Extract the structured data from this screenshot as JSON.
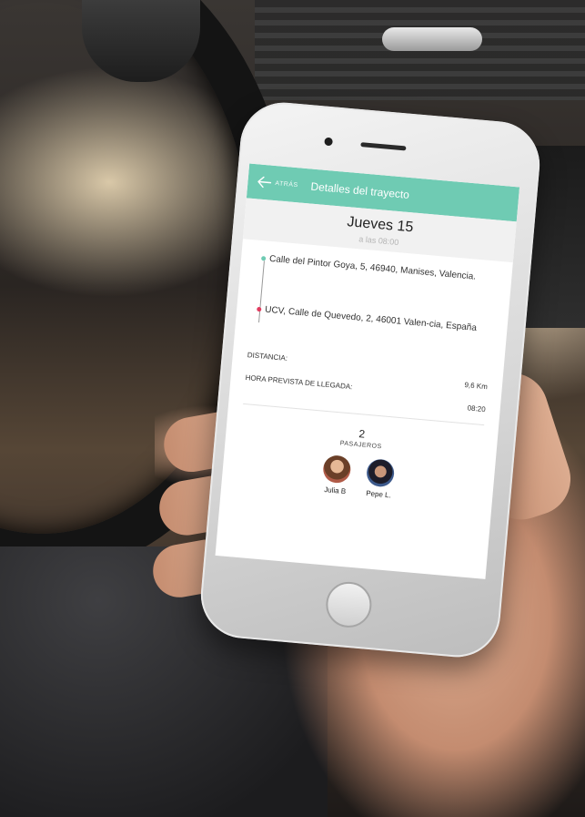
{
  "app": {
    "back_label": "ATRÁS",
    "title": "Detalles del trayecto"
  },
  "date": {
    "day": "Jueves 15",
    "time": "a las 08:00"
  },
  "route": {
    "origin": "Calle del Pintor Goya, 5, 46940, Manises, Valencia.",
    "destination": "UCV, Calle de Quevedo, 2, 46001 Valen-cia, España"
  },
  "details": {
    "distance_label": "DISTANCIA:",
    "distance_value": "9,6 Km",
    "arrival_label": "HORA PREVISTA DE LLEGADA:",
    "arrival_value": "08:20"
  },
  "passengers": {
    "count": "2",
    "label": "PASAJEROS",
    "people": [
      {
        "name": "Julia B"
      },
      {
        "name": "Pepe L."
      }
    ]
  },
  "colors": {
    "accent": "#6fcbb3",
    "destination_dot": "#e23a5e"
  }
}
